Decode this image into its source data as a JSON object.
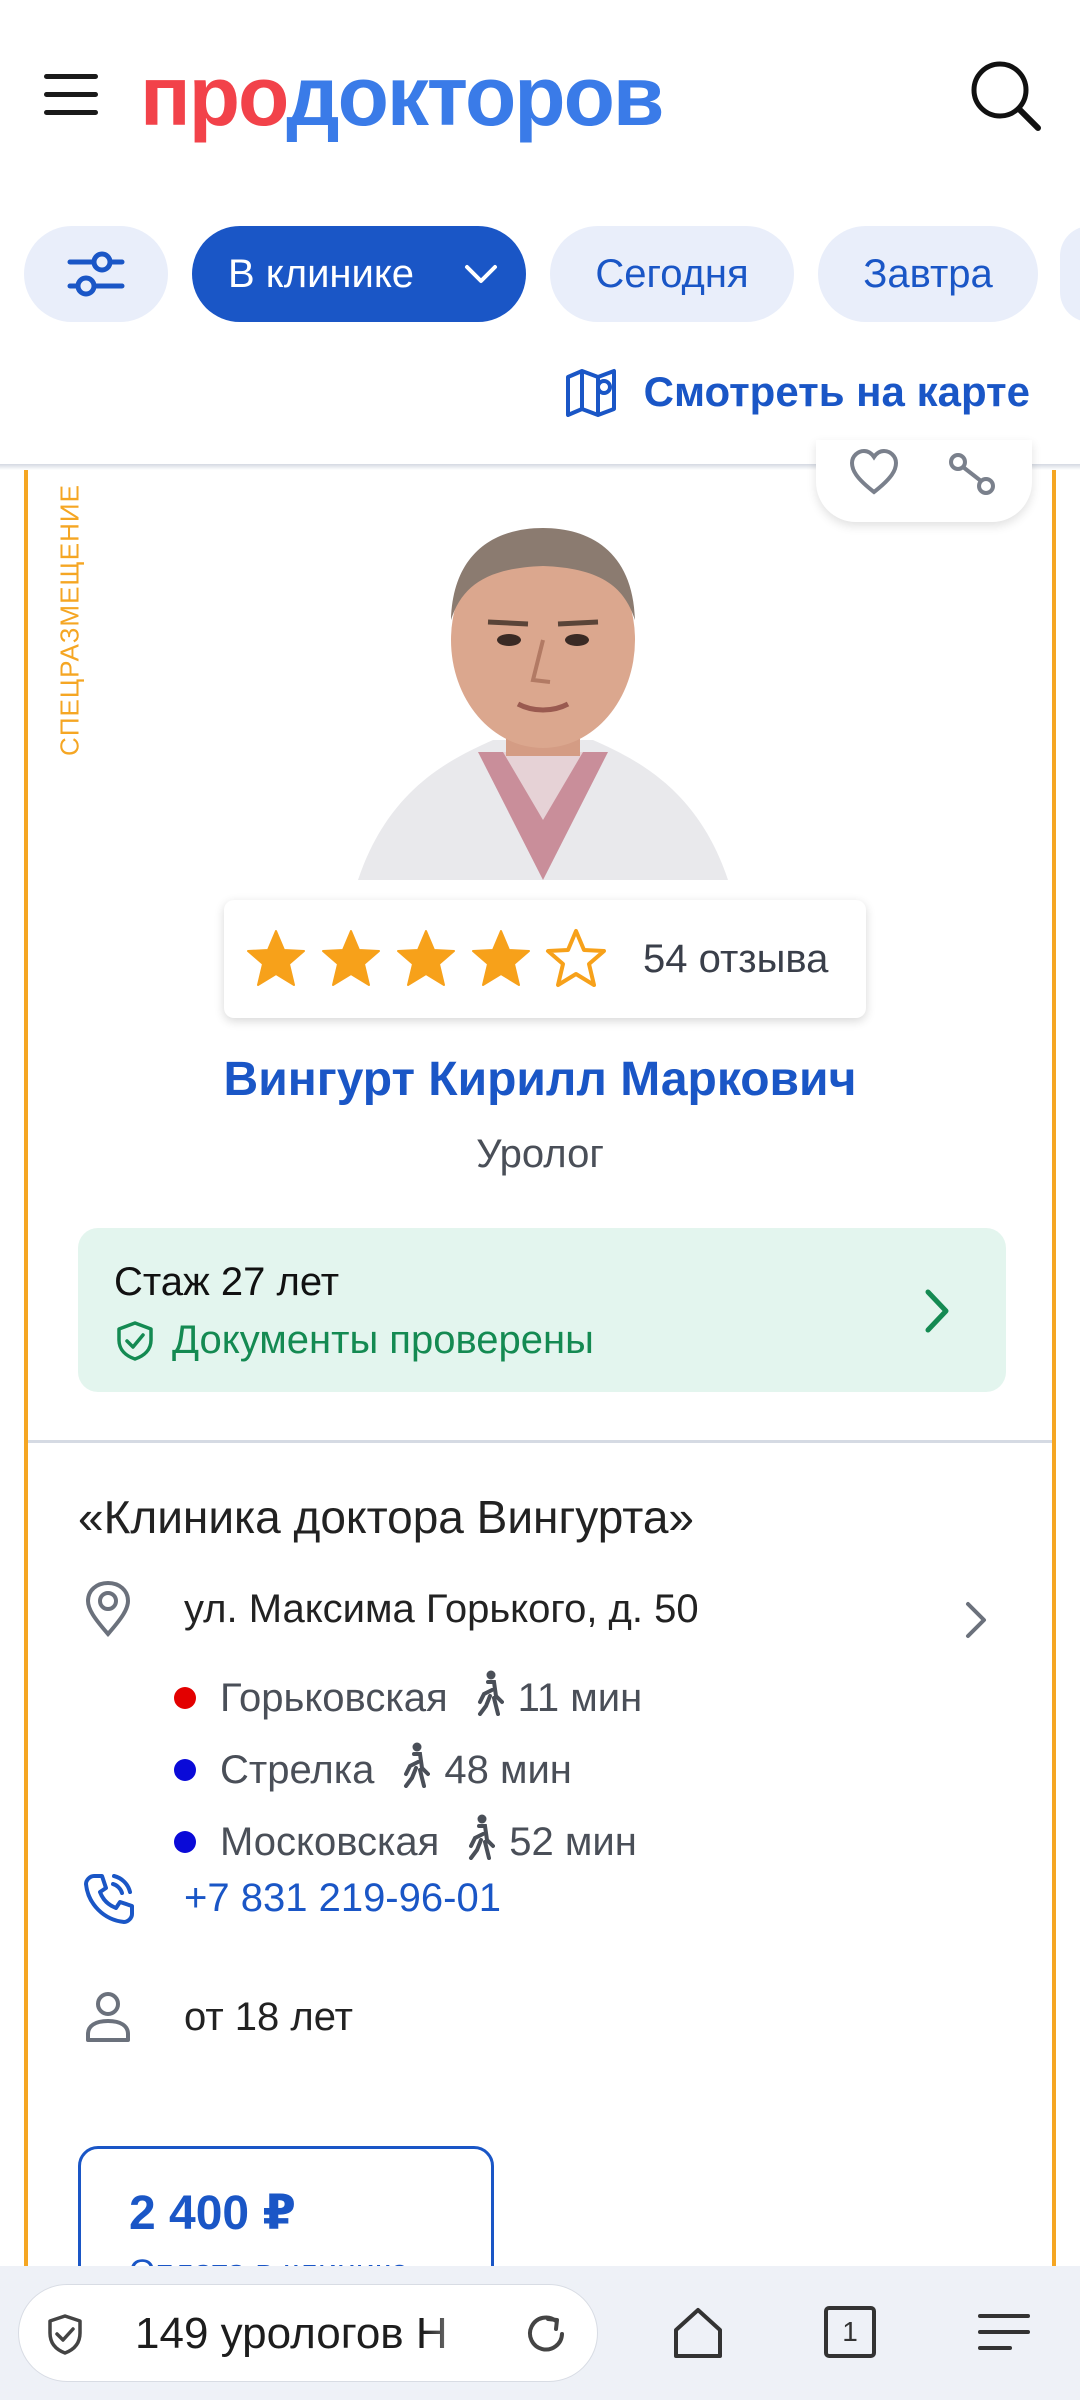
{
  "header": {
    "logo_part1": "про",
    "logo_part2": "докторов",
    "menu_icon": "hamburger-icon",
    "search_icon": "search-icon"
  },
  "filters": {
    "settings_icon": "sliders-icon",
    "chips": [
      "В клинике",
      "Сегодня",
      "Завтра"
    ],
    "map_link": "Смотреть на карте"
  },
  "card": {
    "promo_label": "СПЕЦРАЗМЕЩЕНИЕ",
    "rating": 4,
    "rating_max": 5,
    "reviews": "54 отзыва",
    "doctor_name": "Вингурт Кирилл Маркович",
    "specialty": "Уролог",
    "experience": "Стаж 27 лет",
    "documents": "Документы проверены",
    "clinic_name": "«Клиника доктора Вингурта»",
    "address": "ул. Максима Горького, д. 50",
    "metro": [
      {
        "name": "Горьковская",
        "time": "11 мин",
        "color": "#e30000"
      },
      {
        "name": "Стрелка",
        "time": "48 мин",
        "color": "#0a0ad8"
      },
      {
        "name": "Московская",
        "time": "52 мин",
        "color": "#0a0ad8"
      }
    ],
    "phone": "+7 831 219-96-01",
    "age": "от 18 лет",
    "price": "2 400 ₽",
    "price_note": "Оплата в клинике"
  },
  "browser": {
    "url_text": "149 урологов Н",
    "tab_count": "1"
  },
  "colors": {
    "brand_red": "#f2424a",
    "brand_blue": "#3a7be8",
    "accent": "#1a56c6",
    "promo_border": "#f5a623",
    "verified_green": "#148a52",
    "star": "#f7a11a"
  }
}
